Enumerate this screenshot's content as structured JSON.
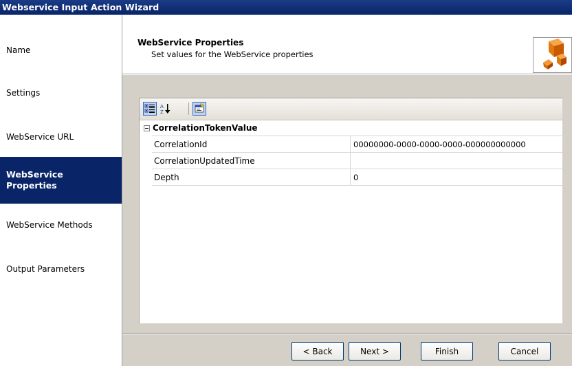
{
  "window": {
    "title": "Webservice Input Action Wizard"
  },
  "steps": [
    {
      "label": "Name",
      "active": false
    },
    {
      "label": "Settings",
      "active": false
    },
    {
      "label": "WebService URL",
      "active": false
    },
    {
      "label": "WebService\nProperties",
      "active": true
    },
    {
      "label": "WebService Methods",
      "active": false
    },
    {
      "label": "Output Parameters",
      "active": false
    }
  ],
  "header": {
    "title": "WebService Properties",
    "subtitle": "Set values for the WebService properties",
    "icon": "wizard-boxes-icon"
  },
  "toolbar": {
    "buttons": [
      {
        "name": "categorized-icon",
        "checked": true
      },
      {
        "name": "alphabetical-icon",
        "checked": false
      },
      {
        "name": "property-pages-icon",
        "checked": false
      }
    ]
  },
  "property_grid": {
    "category": "CorrelationTokenValue",
    "rows": [
      {
        "name": "CorrelationId",
        "value": "00000000-0000-0000-0000-000000000000"
      },
      {
        "name": "CorrelationUpdatedTime",
        "value": ""
      },
      {
        "name": "Depth",
        "value": "0"
      }
    ]
  },
  "buttons": {
    "back": "< Back",
    "next": "Next >",
    "finish": "Finish",
    "cancel": "Cancel"
  },
  "colors": {
    "title_bar": "#0a2468",
    "active_step": "#0a2468",
    "content_bg": "#d4d0c8"
  }
}
